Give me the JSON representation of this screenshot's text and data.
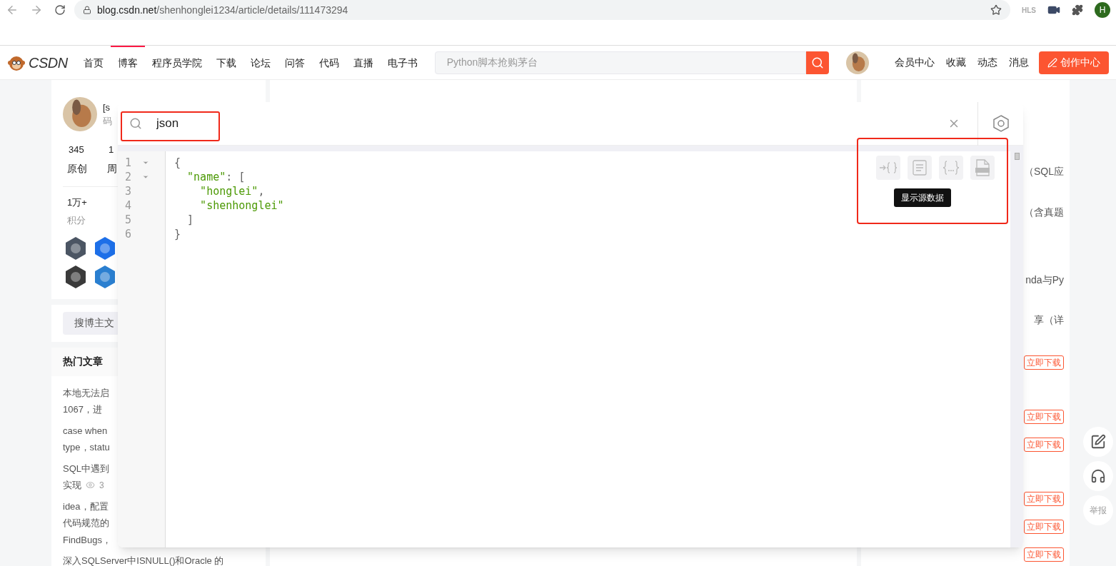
{
  "browser": {
    "url_host": "blog.csdn.net",
    "url_path": "/shenhonglei1234/article/details/111473294",
    "extension_label": "HLS",
    "profile_initial": "H"
  },
  "nav": {
    "logo": "CSDN",
    "items": [
      {
        "label": "首页",
        "selected": false
      },
      {
        "label": "博客",
        "selected": true
      },
      {
        "label": "程序员学院",
        "selected": false
      },
      {
        "label": "下载",
        "selected": false
      },
      {
        "label": "论坛",
        "selected": false
      },
      {
        "label": "问答",
        "selected": false
      },
      {
        "label": "代码",
        "selected": false
      },
      {
        "label": "直播",
        "selected": false
      },
      {
        "label": "电子书",
        "selected": false
      }
    ],
    "search_placeholder": "Python脚本抢购茅台",
    "links": [
      "会员中心",
      "收藏",
      "动态",
      "消息"
    ],
    "create_button": "创作中心"
  },
  "profile": {
    "name": "[s",
    "subtitle": "码",
    "stats": [
      {
        "value": "345",
        "label": "原创"
      },
      {
        "value": "1",
        "label": "周"
      }
    ],
    "points": {
      "value": "1万+",
      "label": "积分"
    },
    "search_button": "搜博主文"
  },
  "hot": {
    "title": "热门文章",
    "items": [
      [
        "本地无法启",
        "1067，进"
      ],
      [
        "case when",
        "type，statu"
      ],
      [
        "SQL中遇到",
        "实现"
      ],
      [
        "idea，配置",
        "代码规范的",
        "FindBugs，"
      ],
      [
        "深入SQLServer中ISNULL()和Oracle 的"
      ]
    ],
    "view_count": "3"
  },
  "right": {
    "items": [
      {
        "kind": "snippet",
        "text": "（SQL应"
      },
      {
        "kind": "snippet",
        "text": "（含真题"
      },
      {
        "kind": "snippet",
        "text": "nda与Py"
      },
      {
        "kind": "snippet",
        "text": "享（详"
      },
      {
        "kind": "download",
        "text": "立即下载"
      },
      {
        "kind": "download",
        "text": "立即下载"
      },
      {
        "kind": "download",
        "text": "立即下载"
      },
      {
        "kind": "download",
        "text": "立即下载"
      },
      {
        "kind": "download",
        "text": "立即下载"
      },
      {
        "kind": "download",
        "text": "立即下载"
      }
    ]
  },
  "float": {
    "report": "举报"
  },
  "viewer": {
    "search_value": "json",
    "lines": [
      {
        "number": "1",
        "foldable": true,
        "tokens": [
          {
            "kind": "punct",
            "text": "{"
          }
        ]
      },
      {
        "number": "2",
        "foldable": true,
        "tokens": [
          {
            "kind": "key",
            "text": "  \"name\""
          },
          {
            "kind": "punct",
            "text": ": ["
          }
        ]
      },
      {
        "number": "3",
        "foldable": false,
        "tokens": [
          {
            "kind": "string",
            "text": "    \"honglei\""
          },
          {
            "kind": "punct",
            "text": ","
          }
        ]
      },
      {
        "number": "4",
        "foldable": false,
        "tokens": [
          {
            "kind": "string",
            "text": "    \"shenhonglei\""
          }
        ]
      },
      {
        "number": "5",
        "foldable": false,
        "tokens": [
          {
            "kind": "punct",
            "text": "  ]"
          }
        ]
      },
      {
        "number": "6",
        "foldable": false,
        "tokens": [
          {
            "kind": "punct",
            "text": "}"
          }
        ]
      }
    ],
    "tools": [
      {
        "kind": "arrow-braces"
      },
      {
        "kind": "lines"
      },
      {
        "kind": "dots-braces"
      },
      {
        "kind": "json-file"
      }
    ],
    "tooltip": "显示源数据"
  }
}
